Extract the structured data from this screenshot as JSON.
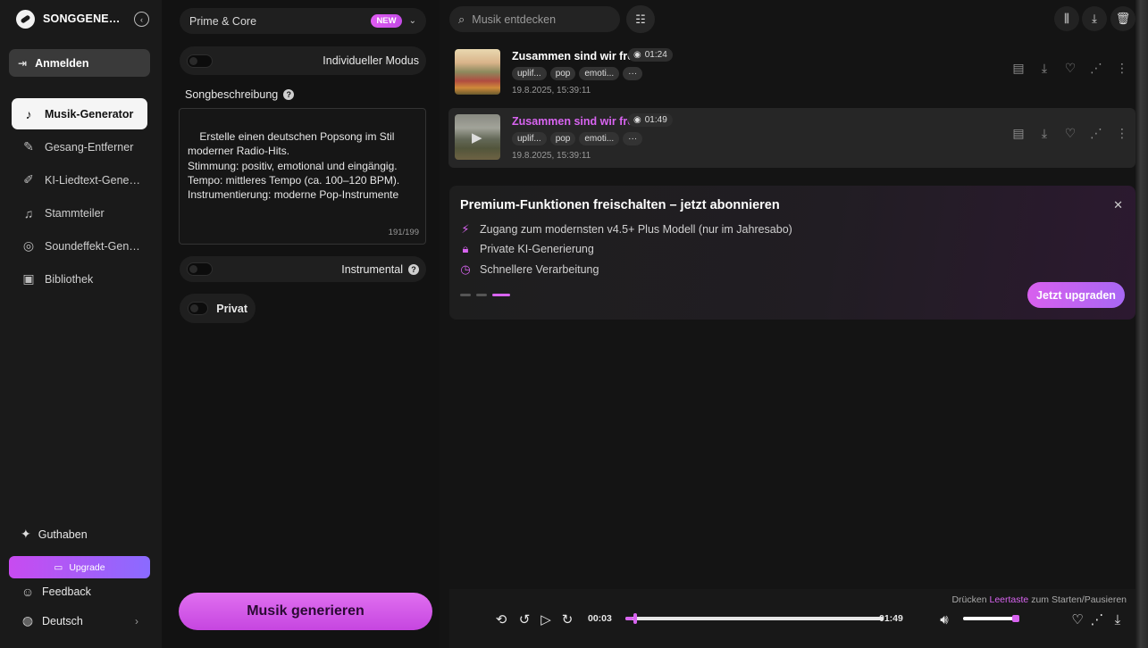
{
  "brand": {
    "name": "SONGGENERATOR"
  },
  "sidebar": {
    "login_label": "Anmelden",
    "items": [
      {
        "label": "Musik-Generator",
        "icon": "music-note-icon",
        "glyph": "♪"
      },
      {
        "label": "Gesang-Entferner",
        "icon": "vocal-remover-icon",
        "glyph": "✎"
      },
      {
        "label": "KI-Liedtext-Generator",
        "icon": "lyrics-icon",
        "glyph": "✐"
      },
      {
        "label": "Stammteiler",
        "icon": "stem-splitter-icon",
        "glyph": "♫"
      },
      {
        "label": "Soundeffekt-Generator",
        "icon": "sound-effect-icon",
        "glyph": "◎"
      },
      {
        "label": "Bibliothek",
        "icon": "library-icon",
        "glyph": "▣"
      }
    ],
    "credits_label": "Guthaben",
    "upgrade_label": "Upgrade",
    "feedback_label": "Feedback",
    "language_label": "Deutsch"
  },
  "form": {
    "model": "Prime & Core",
    "model_badge": "NEW",
    "custom_mode_label": "Individueller Modus",
    "description_label": "Songbeschreibung",
    "description_text": "Erstelle einen deutschen Popsong im Stil\nmoderner Radio-Hits.\nStimmung: positiv, emotional und eingängig.\nTempo: mittleres Tempo (ca. 100–120 BPM).\nInstrumentierung: moderne Pop-Instrumente",
    "description_count": "191/199",
    "instrumental_label": "Instrumental",
    "private_label": "Privat",
    "generate_label": "Musik generieren"
  },
  "search": {
    "placeholder": "Musik entdecken"
  },
  "songs": [
    {
      "title": "Zusammen sind wir frei",
      "duration": "01:24",
      "tags": [
        "uplif...",
        "pop",
        "emoti...",
        "···"
      ],
      "date": "19.8.2025, 15:39:11"
    },
    {
      "title": "Zusammen sind wir frei",
      "duration": "01:49",
      "tags": [
        "uplif...",
        "pop",
        "emoti...",
        "···"
      ],
      "date": "19.8.2025, 15:39:11"
    }
  ],
  "promo": {
    "title": "Premium-Funktionen freischalten – jetzt abonnieren",
    "features": [
      "Zugang zum modernsten v4.5+ Plus Modell (nur im Jahresabo)",
      "Private KI-Generierung",
      "Schnellere Verarbeitung"
    ],
    "cta": "Jetzt upgraden"
  },
  "player": {
    "hint_prefix": "Drücken",
    "hint_key": "Leertaste",
    "hint_suffix": "zum Starten/Pausieren",
    "current_time": "00:03",
    "total_time": "01:49",
    "progress": 0.03,
    "volume": 0.95
  },
  "colors": {
    "accent": "#d864f0",
    "background": "#121212"
  }
}
